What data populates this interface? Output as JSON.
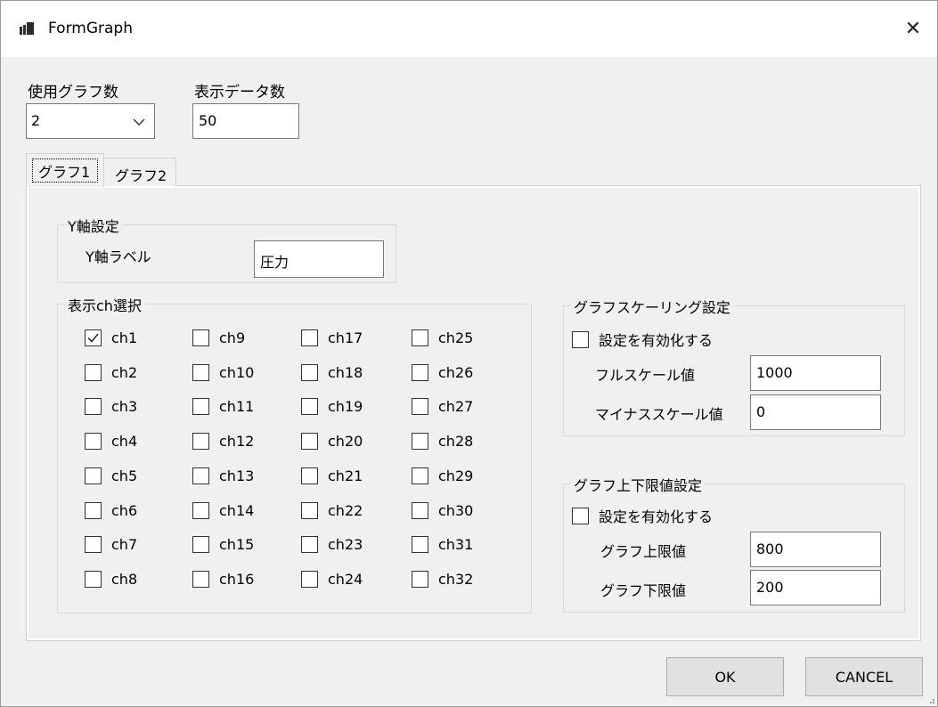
{
  "window": {
    "title": "FormGraph",
    "close_glyph": "✕",
    "icon": "app-form-icon"
  },
  "top": {
    "graph_count_label": "使用グラフ数",
    "graph_count_value": "2",
    "data_count_label": "表示データ数",
    "data_count_value": "50"
  },
  "tabs": [
    {
      "label": "グラフ1",
      "selected": true
    },
    {
      "label": "グラフ2",
      "selected": false
    }
  ],
  "yaxis": {
    "group_title": "Y軸設定",
    "label_caption": "Y軸ラベル",
    "label_value": "圧力"
  },
  "channels": {
    "group_title": "表示ch選択",
    "items": [
      {
        "label": "ch1",
        "checked": true
      },
      {
        "label": "ch2",
        "checked": false
      },
      {
        "label": "ch3",
        "checked": false
      },
      {
        "label": "ch4",
        "checked": false
      },
      {
        "label": "ch5",
        "checked": false
      },
      {
        "label": "ch6",
        "checked": false
      },
      {
        "label": "ch7",
        "checked": false
      },
      {
        "label": "ch8",
        "checked": false
      },
      {
        "label": "ch9",
        "checked": false
      },
      {
        "label": "ch10",
        "checked": false
      },
      {
        "label": "ch11",
        "checked": false
      },
      {
        "label": "ch12",
        "checked": false
      },
      {
        "label": "ch13",
        "checked": false
      },
      {
        "label": "ch14",
        "checked": false
      },
      {
        "label": "ch15",
        "checked": false
      },
      {
        "label": "ch16",
        "checked": false
      },
      {
        "label": "ch17",
        "checked": false
      },
      {
        "label": "ch18",
        "checked": false
      },
      {
        "label": "ch19",
        "checked": false
      },
      {
        "label": "ch20",
        "checked": false
      },
      {
        "label": "ch21",
        "checked": false
      },
      {
        "label": "ch22",
        "checked": false
      },
      {
        "label": "ch23",
        "checked": false
      },
      {
        "label": "ch24",
        "checked": false
      },
      {
        "label": "ch25",
        "checked": false
      },
      {
        "label": "ch26",
        "checked": false
      },
      {
        "label": "ch27",
        "checked": false
      },
      {
        "label": "ch28",
        "checked": false
      },
      {
        "label": "ch29",
        "checked": false
      },
      {
        "label": "ch30",
        "checked": false
      },
      {
        "label": "ch31",
        "checked": false
      },
      {
        "label": "ch32",
        "checked": false
      }
    ]
  },
  "scaling": {
    "group_title": "グラフスケーリング設定",
    "enable_label": "設定を有効化する",
    "enabled": false,
    "full_scale_label": "フルスケール値",
    "full_scale_value": "1000",
    "minus_scale_label": "マイナススケール値",
    "minus_scale_value": "0"
  },
  "limits": {
    "group_title": "グラフ上下限値設定",
    "enable_label": "設定を有効化する",
    "enabled": false,
    "upper_label": "グラフ上限値",
    "upper_value": "800",
    "lower_label": "グラフ下限値",
    "lower_value": "200"
  },
  "buttons": {
    "ok": "OK",
    "cancel": "CANCEL"
  }
}
